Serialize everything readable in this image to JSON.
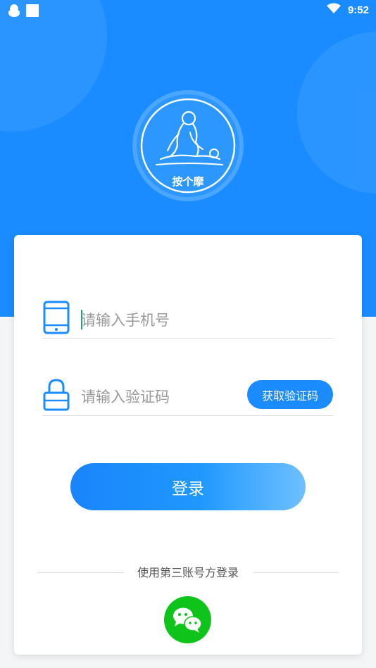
{
  "status_bar": {
    "time": "9:52",
    "left_icons": [
      "qq-icon",
      "notification-square-icon"
    ],
    "right_icons": [
      "wifi-icon"
    ]
  },
  "logo": {
    "text": "按个摩",
    "icon": "massage-logo-icon"
  },
  "form": {
    "phone": {
      "icon": "phone-icon",
      "placeholder": "请输入手机号",
      "value": ""
    },
    "code": {
      "icon": "lock-icon",
      "placeholder": "请输入验证码",
      "value": "",
      "button_label": "获取验证码"
    },
    "login_label": "登录"
  },
  "third_party": {
    "label": "使用第三账号方登录",
    "wechat_icon": "wechat-icon"
  },
  "colors": {
    "primary": "#1a8cff",
    "wechat_green": "#0ec41b",
    "placeholder": "#9a9a9a"
  }
}
